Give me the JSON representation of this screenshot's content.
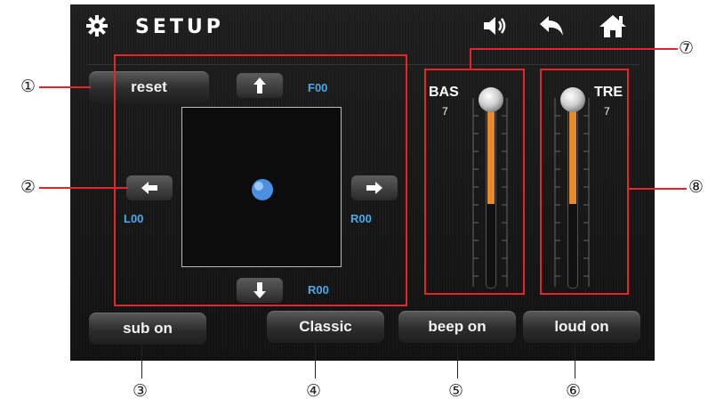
{
  "header": {
    "title": "SETUP"
  },
  "buttons": {
    "reset": "reset",
    "sub": "sub on",
    "classic": "Classic",
    "beep": "beep on",
    "loud": "loud on"
  },
  "balance": {
    "front": "F00",
    "left": "L00",
    "right": "R00",
    "rear": "R00"
  },
  "faders": {
    "bass": {
      "label": "BAS",
      "value": "7",
      "level": 0.55
    },
    "treble": {
      "label": "TRE",
      "value": "7",
      "level": 0.55
    }
  },
  "callouts": [
    "①",
    "②",
    "③",
    "④",
    "⑤",
    "⑥",
    "⑦",
    "⑧"
  ],
  "colors": {
    "accent": "#e8232a",
    "value_blue": "#4aa8e8",
    "fader_fill": "#e88a2a"
  }
}
